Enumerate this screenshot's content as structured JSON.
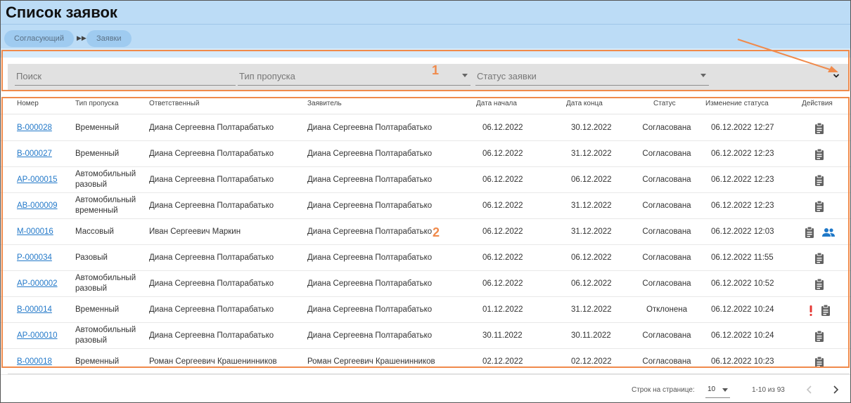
{
  "header": {
    "title": "Список заявок",
    "breadcrumbs": [
      "Согласующий",
      "Заявки"
    ]
  },
  "filters": {
    "search_placeholder": "Поиск",
    "pass_type_placeholder": "Тип пропуска",
    "status_placeholder": "Статус заявки"
  },
  "annotations": {
    "filters_marker": "1",
    "table_marker": "2"
  },
  "table": {
    "columns": [
      "Номер",
      "Тип пропуска",
      "Ответственный",
      "Заявитель",
      "Дата начала",
      "Дата конца",
      "Статус",
      "Изменение статуса",
      "Действия"
    ],
    "rows": [
      {
        "number": "В-000028",
        "type": "Временный",
        "responsible": "Диана Сергеевна Полтарабатько",
        "applicant": "Диана Сергеевна Полтарабатько",
        "start": "06.12.2022",
        "end": "30.12.2022",
        "status": "Согласована",
        "changed": "06.12.2022 12:27",
        "icons": [
          "clipboard-icon"
        ]
      },
      {
        "number": "В-000027",
        "type": "Временный",
        "responsible": "Диана Сергеевна Полтарабатько",
        "applicant": "Диана Сергеевна Полтарабатько",
        "start": "06.12.2022",
        "end": "31.12.2022",
        "status": "Согласована",
        "changed": "06.12.2022 12:23",
        "icons": [
          "clipboard-icon"
        ]
      },
      {
        "number": "АР-000015",
        "type": "Автомобильный разовый",
        "responsible": "Диана Сергеевна Полтарабатько",
        "applicant": "Диана Сергеевна Полтарабатько",
        "start": "06.12.2022",
        "end": "06.12.2022",
        "status": "Согласована",
        "changed": "06.12.2022 12:23",
        "icons": [
          "clipboard-icon"
        ]
      },
      {
        "number": "АВ-000009",
        "type": "Автомобильный временный",
        "responsible": "Диана Сергеевна Полтарабатько",
        "applicant": "Диана Сергеевна Полтарабатько",
        "start": "06.12.2022",
        "end": "31.12.2022",
        "status": "Согласована",
        "changed": "06.12.2022 12:23",
        "icons": [
          "clipboard-icon"
        ]
      },
      {
        "number": "М-000016",
        "type": "Массовый",
        "responsible": "Иван Сергеевич Маркин",
        "applicant": "Диана Сергеевна Полтарабатько",
        "start": "06.12.2022",
        "end": "31.12.2022",
        "status": "Согласована",
        "changed": "06.12.2022 12:03",
        "icons": [
          "clipboard-icon",
          "group-icon"
        ]
      },
      {
        "number": "Р-000034",
        "type": "Разовый",
        "responsible": "Диана Сергеевна Полтарабатько",
        "applicant": "Диана Сергеевна Полтарабатько",
        "start": "06.12.2022",
        "end": "06.12.2022",
        "status": "Согласована",
        "changed": "06.12.2022 11:55",
        "icons": [
          "clipboard-icon"
        ]
      },
      {
        "number": "АР-000002",
        "type": "Автомобильный разовый",
        "responsible": "Диана Сергеевна Полтарабатько",
        "applicant": "Диана Сергеевна Полтарабатько",
        "start": "06.12.2022",
        "end": "06.12.2022",
        "status": "Согласована",
        "changed": "06.12.2022 10:52",
        "icons": [
          "clipboard-icon"
        ]
      },
      {
        "number": "В-000014",
        "type": "Временный",
        "responsible": "Диана Сергеевна Полтарабатько",
        "applicant": "Диана Сергеевна Полтарабатько",
        "start": "01.12.2022",
        "end": "31.12.2022",
        "status": "Отклонена",
        "changed": "06.12.2022 10:24",
        "icons": [
          "exclamation-icon",
          "clipboard-icon"
        ]
      },
      {
        "number": "АР-000010",
        "type": "Автомобильный разовый",
        "responsible": "Диана Сергеевна Полтарабатько",
        "applicant": "Диана Сергеевна Полтарабатько",
        "start": "30.11.2022",
        "end": "30.11.2022",
        "status": "Согласована",
        "changed": "06.12.2022 10:24",
        "icons": [
          "clipboard-icon"
        ]
      },
      {
        "number": "В-000018",
        "type": "Временный",
        "responsible": "Роман Сергеевич Крашенинников",
        "applicant": "Роман Сергеевич Крашенинников",
        "start": "02.12.2022",
        "end": "02.12.2022",
        "status": "Согласована",
        "changed": "06.12.2022 10:23",
        "icons": [
          "clipboard-icon"
        ]
      }
    ]
  },
  "pagination": {
    "rows_per_page_label": "Строк на странице:",
    "rows_per_page": "10",
    "range": "1-10 из 93"
  },
  "colors": {
    "header_bg": "#bcdcf6",
    "link": "#2379c9",
    "annotation": "#f08a4b",
    "alert": "#e53935",
    "group_icon": "#1e78c8",
    "clipboard_icon": "#616161"
  }
}
